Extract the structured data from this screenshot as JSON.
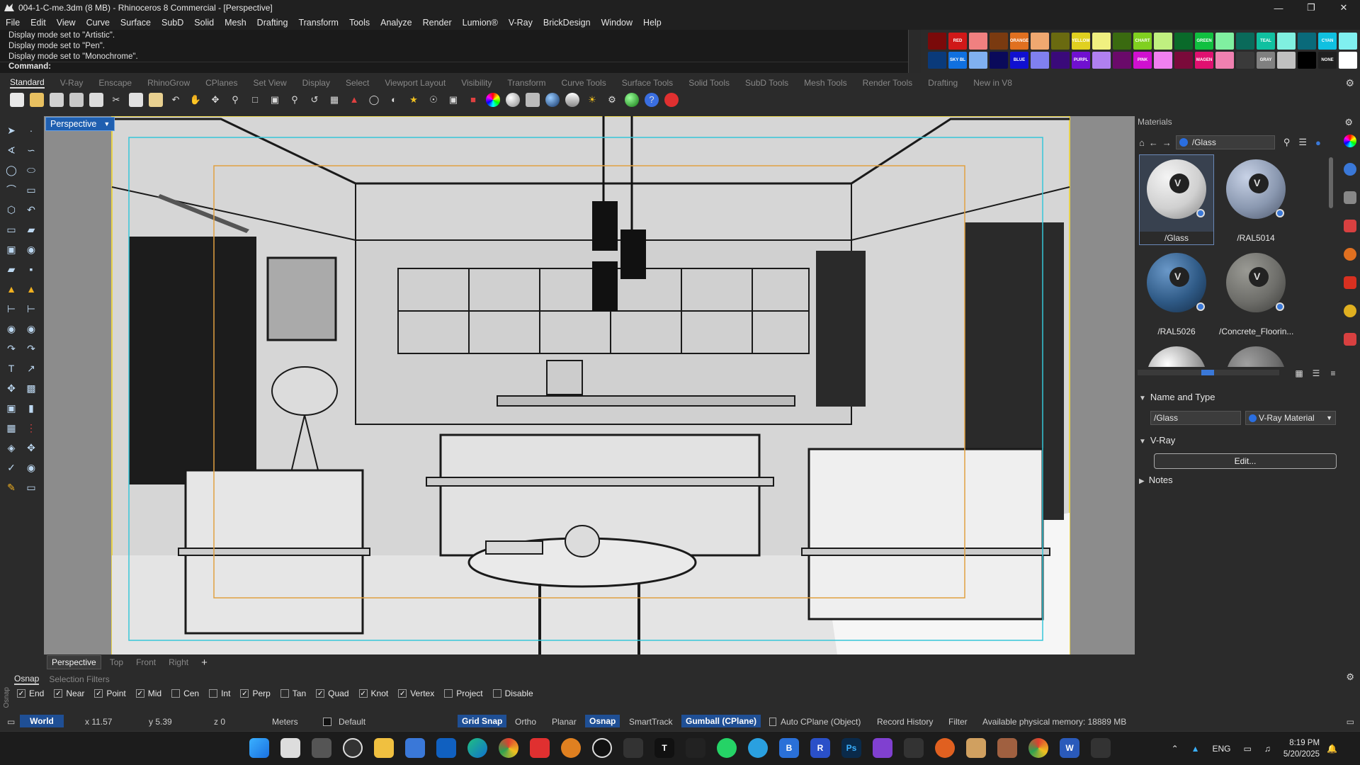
{
  "window": {
    "title": "004-1-C-me.3dm (8 MB) - Rhinoceros 8 Commercial - [Perspective]"
  },
  "menu": [
    "File",
    "Edit",
    "View",
    "Curve",
    "Surface",
    "SubD",
    "Solid",
    "Mesh",
    "Drafting",
    "Transform",
    "Tools",
    "Analyze",
    "Render",
    "Lumion®",
    "V-Ray",
    "BrickDesign",
    "Window",
    "Help"
  ],
  "command": {
    "history": [
      "Display mode set to \"Artistic\".",
      "Display mode set to \"Pen\".",
      "Display mode set to \"Monochrome\"."
    ],
    "prompt": "Command:"
  },
  "palette": [
    {
      "color": "#7a0a0a",
      "label": ""
    },
    {
      "color": "#d01818",
      "label": "RED"
    },
    {
      "color": "#f08080",
      "label": ""
    },
    {
      "color": "#7a3a10",
      "label": ""
    },
    {
      "color": "#e07020",
      "label": "ORANGE"
    },
    {
      "color": "#f0a870",
      "label": ""
    },
    {
      "color": "#6a6a10",
      "label": ""
    },
    {
      "color": "#e0d020",
      "label": "YELLOW"
    },
    {
      "color": "#f0f080",
      "label": ""
    },
    {
      "color": "#3a6a10",
      "label": ""
    },
    {
      "color": "#80d020",
      "label": "CHART"
    },
    {
      "color": "#c0f080",
      "label": ""
    },
    {
      "color": "#0a6a2a",
      "label": ""
    },
    {
      "color": "#10c040",
      "label": "GREEN"
    },
    {
      "color": "#80f0a0",
      "label": ""
    },
    {
      "color": "#0a6a5a",
      "label": ""
    },
    {
      "color": "#10c0a0",
      "label": "TEAL"
    },
    {
      "color": "#80f0e0",
      "label": ""
    },
    {
      "color": "#0a6a7a",
      "label": ""
    },
    {
      "color": "#10c0e0",
      "label": "CYAN"
    },
    {
      "color": "#80f0f0",
      "label": ""
    },
    {
      "color": "#0a3a7a",
      "label": ""
    },
    {
      "color": "#1070e0",
      "label": "SKY BL"
    },
    {
      "color": "#80b0f0",
      "label": ""
    },
    {
      "color": "#0a0a5a",
      "label": ""
    },
    {
      "color": "#1010d0",
      "label": "BLUE"
    },
    {
      "color": "#8080f0",
      "label": ""
    },
    {
      "color": "#3a0a7a",
      "label": ""
    },
    {
      "color": "#7010d0",
      "label": "PURPL"
    },
    {
      "color": "#b080f0",
      "label": ""
    },
    {
      "color": "#6a0a6a",
      "label": ""
    },
    {
      "color": "#d010d0",
      "label": "PINK"
    },
    {
      "color": "#f080f0",
      "label": ""
    },
    {
      "color": "#7a0a3a",
      "label": ""
    },
    {
      "color": "#e01070",
      "label": "MAGEN"
    },
    {
      "color": "#f080b0",
      "label": ""
    },
    {
      "color": "#3a3a3a",
      "label": ""
    },
    {
      "color": "#808080",
      "label": "GRAY"
    },
    {
      "color": "#c0c0c0",
      "label": ""
    },
    {
      "color": "#000000",
      "label": ""
    },
    {
      "color": "#202020",
      "label": "NONE"
    },
    {
      "color": "#ffffff",
      "label": ""
    }
  ],
  "tabs": {
    "items": [
      "Standard",
      "V-Ray",
      "Enscape",
      "RhinoGrow",
      "CPlanes",
      "Set View",
      "Display",
      "Select",
      "Viewport Layout",
      "Visibility",
      "Transform",
      "Curve Tools",
      "Surface Tools",
      "Solid Tools",
      "SubD Tools",
      "Mesh Tools",
      "Render Tools",
      "Drafting",
      "New in V8"
    ],
    "active": 0
  },
  "viewport": {
    "label": "Perspective",
    "bottom_tabs": [
      "Perspective",
      "Top",
      "Front",
      "Right"
    ],
    "add_tab": "+"
  },
  "materials": {
    "panel_title": "Materials",
    "path": "/Glass",
    "items": [
      {
        "name": "/Glass",
        "color": "#d0d0d0",
        "selected": true
      },
      {
        "name": "/RAL5014",
        "color": "#8a98b0",
        "selected": false
      },
      {
        "name": "/RAL5026",
        "color": "#2f5a86",
        "selected": false
      },
      {
        "name": "/Concrete_Floorin...",
        "color": "#6e6e6a",
        "selected": false
      },
      {
        "name": "",
        "color": "#9a9a9a",
        "selected": false
      },
      {
        "name": "",
        "color": "#6a6a6a",
        "selected": false
      }
    ],
    "name_and_type_label": "Name and Type",
    "name_value": "/Glass",
    "type_value": "V-Ray Material",
    "vray_label": "V-Ray",
    "edit_label": "Edit...",
    "notes_label": "Notes"
  },
  "osnap": {
    "tabs": [
      "Osnap",
      "Selection Filters"
    ],
    "side_label": "Osnap",
    "items": [
      {
        "label": "End",
        "checked": true
      },
      {
        "label": "Near",
        "checked": true
      },
      {
        "label": "Point",
        "checked": true
      },
      {
        "label": "Mid",
        "checked": true
      },
      {
        "label": "Cen",
        "checked": false
      },
      {
        "label": "Int",
        "checked": false
      },
      {
        "label": "Perp",
        "checked": true
      },
      {
        "label": "Tan",
        "checked": false
      },
      {
        "label": "Quad",
        "checked": true
      },
      {
        "label": "Knot",
        "checked": true
      },
      {
        "label": "Vertex",
        "checked": true
      },
      {
        "label": "Project",
        "checked": false
      },
      {
        "label": "Disable",
        "checked": false
      }
    ]
  },
  "status": {
    "cplane": "World",
    "x": "x 11.57",
    "y": "y 5.39",
    "z": "z 0",
    "units": "Meters",
    "layer": "Default",
    "grid_snap": "Grid Snap",
    "ortho": "Ortho",
    "planar": "Planar",
    "osnap": "Osnap",
    "smarttrack": "SmartTrack",
    "gumball": "Gumball (CPlane)",
    "auto_cplane": "Auto CPlane (Object)",
    "record_history": "Record History",
    "filter": "Filter",
    "memory": "Available physical memory: 18889 MB"
  },
  "taskbar": {
    "lang": "ENG",
    "time": "8:19 PM",
    "date": "5/20/2025"
  }
}
